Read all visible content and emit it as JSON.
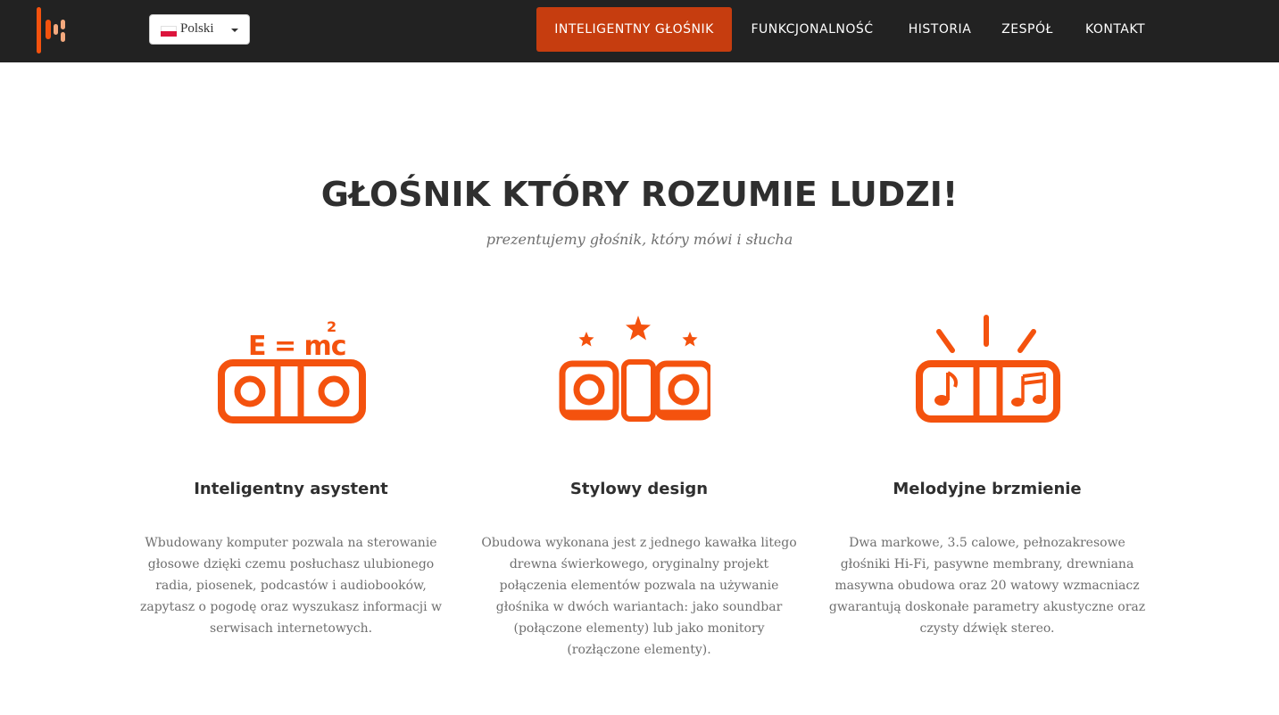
{
  "colors": {
    "accent": "#c63d0f",
    "icon_orange": "#f4520e",
    "navbar_bg": "#222222",
    "logo_light": "#f3a97e"
  },
  "navbar": {
    "logo_icon": "speaker-bars-logo",
    "language": {
      "selected": "Polski",
      "flag_icon": "poland-flag-icon"
    },
    "items": [
      {
        "label": "INTELIGENTNY GŁOŚNIK",
        "active": true
      },
      {
        "label": "FUNKCJONALNOŚĆ",
        "active": false
      },
      {
        "label": "HISTORIA",
        "active": false
      },
      {
        "label": "ZESPÓŁ",
        "active": false
      },
      {
        "label": "KONTAKT",
        "active": false
      }
    ]
  },
  "hero": {
    "title": "GŁOŚNIK KTÓRY ROZUMIE LUDZI!",
    "subtitle": "prezentujemy głośnik, który mówi i słucha"
  },
  "features": [
    {
      "icon": "smart-speaker-emc2-icon",
      "formula": "E = mc",
      "formula_exponent": "2",
      "title": "Inteligentny asystent",
      "text": "Wbudowany komputer pozwala na sterowanie głosowe dzięki czemu posłuchasz ulubionego radia, piosenek, podcastów i audiobooków, zapytasz o pogodę oraz wyszukasz informacji w serwisach internetowych."
    },
    {
      "icon": "speaker-stars-icon",
      "title": "Stylowy design",
      "text": "Obudowa wykonana jest z jednego kawałka litego drewna świerkowego, oryginalny projekt połączenia elementów pozwala na używanie głośnika w dwóch wariantach: jako soundbar (połączone elementy) lub jako monitory (rozłączone elementy)."
    },
    {
      "icon": "speaker-music-notes-icon",
      "title": "Melodyjne brzmienie",
      "text": "Dwa markowe, 3.5 calowe, pełnozakresowe głośniki Hi-Fi, pasywne membrany, drewniana masywna obudowa oraz 20 watowy wzmacniacz gwarantują doskonałe parametry akustyczne oraz czysty dźwięk stereo."
    }
  ]
}
